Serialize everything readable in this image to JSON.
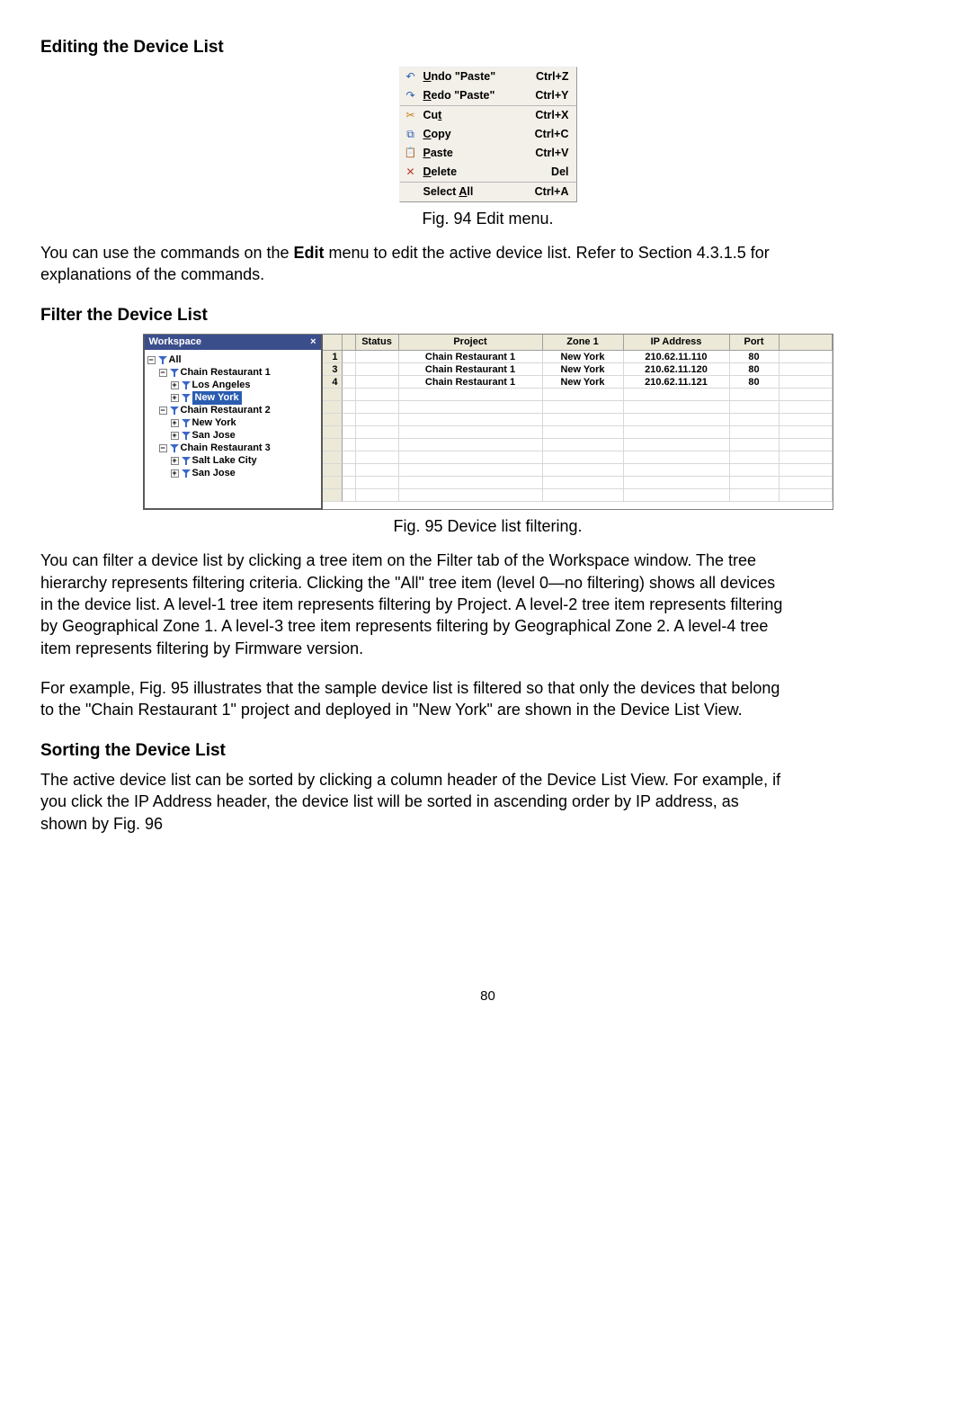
{
  "headings": {
    "editing": "Editing the Device List",
    "filter": "Filter the Device List",
    "sorting": "Sorting the Device List"
  },
  "captions": {
    "fig94": "Fig. 94 Edit menu.",
    "fig95": "Fig. 95 Device list filtering."
  },
  "edit_menu": {
    "undo": "ndo \"Paste\"",
    "undo_pre": "U",
    "undo_sc": "Ctrl+Z",
    "redo": "edo \"Paste\"",
    "redo_pre": "R",
    "redo_sc": "Ctrl+Y",
    "cut": "Cu",
    "cut_u": "t",
    "cut_sc": "Ctrl+X",
    "copy_u": "C",
    "copy": "opy",
    "copy_sc": "Ctrl+C",
    "paste_u": "P",
    "paste": "aste",
    "paste_sc": "Ctrl+V",
    "delete_u": "D",
    "delete": "elete",
    "delete_sc": "Del",
    "select": "Select ",
    "select_u": "A",
    "select_post": "ll",
    "select_sc": "Ctrl+A"
  },
  "para1a": "You can use the commands on the ",
  "para1b": "Edit",
  "para1c": " menu to edit the active device list. Refer to Section 4.3.1.5 for explanations of the commands.",
  "workspace": {
    "title": "Workspace",
    "close": "×",
    "tree": {
      "all": "All",
      "cr1": "Chain Restaurant 1",
      "la": "Los Angeles",
      "ny": "New York",
      "cr2": "Chain Restaurant 2",
      "ny2": "New York",
      "sj": "San Jose",
      "cr3": "Chain Restaurant 3",
      "slc": "Salt Lake City",
      "sj2": "San Jose"
    }
  },
  "table": {
    "headers": {
      "status": "Status",
      "project": "Project",
      "zone1": "Zone 1",
      "ip": "IP Address",
      "port": "Port"
    },
    "rows": [
      {
        "n": "1",
        "project": "Chain Restaurant 1",
        "zone": "New York",
        "ip": "210.62.11.110",
        "port": "80"
      },
      {
        "n": "3",
        "project": "Chain Restaurant 1",
        "zone": "New York",
        "ip": "210.62.11.120",
        "port": "80"
      },
      {
        "n": "4",
        "project": "Chain Restaurant 1",
        "zone": "New York",
        "ip": "210.62.11.121",
        "port": "80"
      }
    ]
  },
  "para2": "You can filter a device list by clicking a tree item on the Filter tab of the Workspace window. The tree hierarchy represents filtering criteria. Clicking the \"All\" tree item (level 0—no filtering) shows all devices in the device list. A level-1 tree item represents filtering by Project. A level-2 tree item represents filtering by Geographical Zone 1. A level-3 tree item represents filtering by Geographical Zone 2. A level-4 tree item represents filtering by Firmware version.",
  "para3": "For example, Fig. 95 illustrates that the sample device list is filtered so that only the devices that belong to the \"Chain Restaurant 1\" project and deployed in \"New York\" are shown in the Device List View.",
  "para4": "The active device list can be sorted by clicking a column header of the Device List View. For example, if you click the IP Address header, the device list will be sorted in ascending order by IP address, as shown by Fig. 96",
  "page": "80"
}
